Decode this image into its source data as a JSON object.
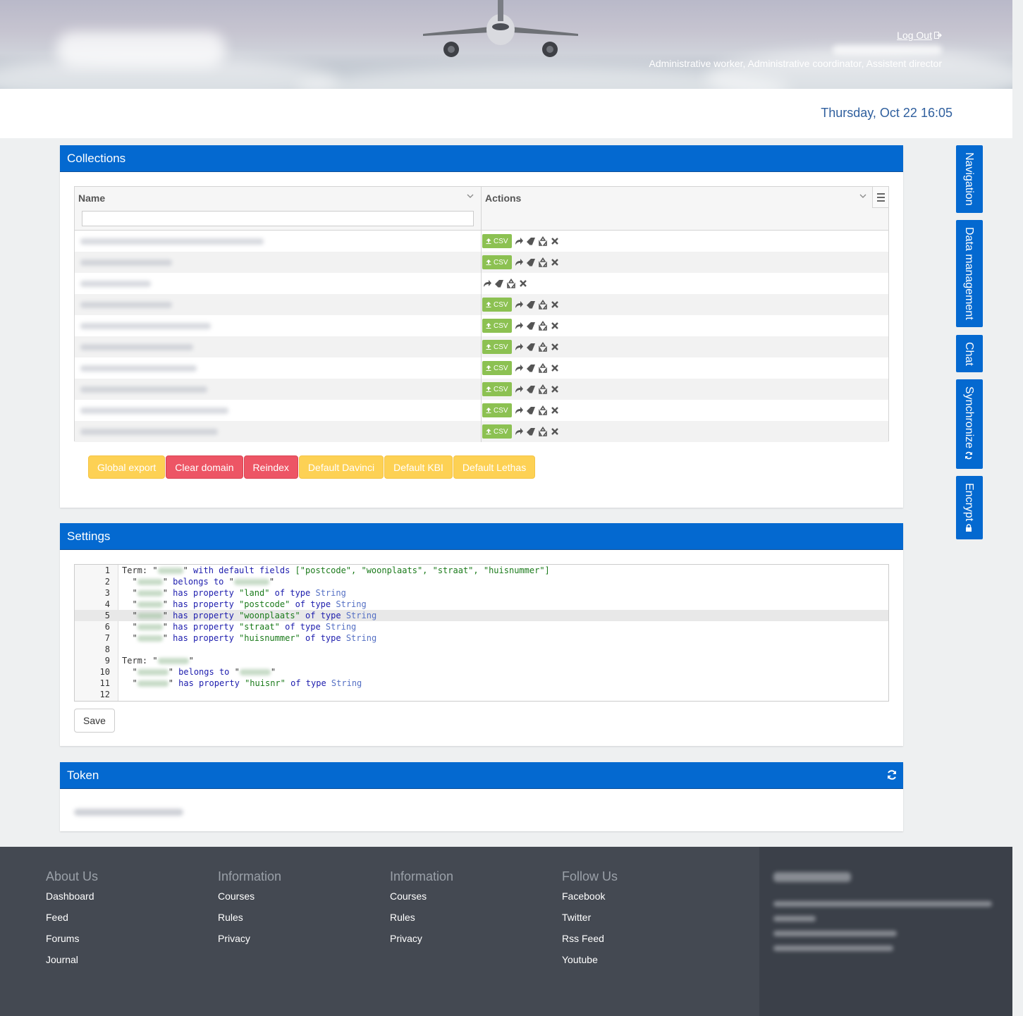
{
  "header": {
    "logout_label": "Log Out",
    "roles": "Administrative worker, Administrative coordinator, Assistent director",
    "datetime": "Thursday, Oct 22 16:05"
  },
  "collections": {
    "title": "Collections",
    "columns": {
      "name": "Name",
      "actions": "Actions"
    },
    "filter_placeholder": "",
    "csv_label": "CSV",
    "rows": [
      {
        "csv": true
      },
      {
        "csv": true
      },
      {
        "csv": false
      },
      {
        "csv": true
      },
      {
        "csv": true
      },
      {
        "csv": true
      },
      {
        "csv": true
      },
      {
        "csv": true
      },
      {
        "csv": true
      },
      {
        "csv": true
      }
    ],
    "buttons": {
      "global_export": "Global export",
      "clear_domain": "Clear domain",
      "reindex": "Reindex",
      "default_davinci": "Default Davinci",
      "default_kbi": "Default KBI",
      "default_lethas": "Default Lethas"
    },
    "colors": {
      "csv": "#8cc152",
      "warning": "#fdd154",
      "danger": "#ed5565"
    }
  },
  "settings": {
    "title": "Settings",
    "save_label": "Save",
    "line_numbers": [
      "1",
      "2",
      "3",
      "4",
      "5",
      "6",
      "7",
      "8",
      "9",
      "10",
      "11",
      "12"
    ],
    "active_line": 5,
    "code": {
      "term_label": "Term:",
      "with_default_fields": "with default fields",
      "fields": "[\"postcode\", \"woonplaats\", \"straat\", \"huisnummer\"]",
      "belongs_to": "belongs to",
      "has_property": "has property",
      "of_type": "of type",
      "type_string": "String",
      "props_block1": [
        "\"land\"",
        "\"postcode\"",
        "\"woonplaats\"",
        "\"straat\"",
        "\"huisnummer\""
      ],
      "prop_block2": "\"huisnr\""
    }
  },
  "token": {
    "title": "Token"
  },
  "sidetabs": [
    "Navigation",
    "Data management",
    "Chat",
    "Synchronize",
    "Encrypt"
  ],
  "footer": {
    "col1": {
      "title": "About Us",
      "links": [
        "Dashboard",
        "Feed",
        "Forums",
        "Journal"
      ]
    },
    "col2": {
      "title": "Information",
      "links": [
        "Courses",
        "Rules",
        "Privacy"
      ]
    },
    "col3": {
      "title": "Information",
      "links": [
        "Courses",
        "Rules",
        "Privacy"
      ]
    },
    "col4": {
      "title": "Follow Us",
      "links": [
        "Facebook",
        "Twitter",
        "Rss Feed",
        "Youtube"
      ]
    }
  },
  "theme": {
    "primary": "#0469d0",
    "footer_bg": "#444952",
    "date_color": "#2f5f9e"
  }
}
